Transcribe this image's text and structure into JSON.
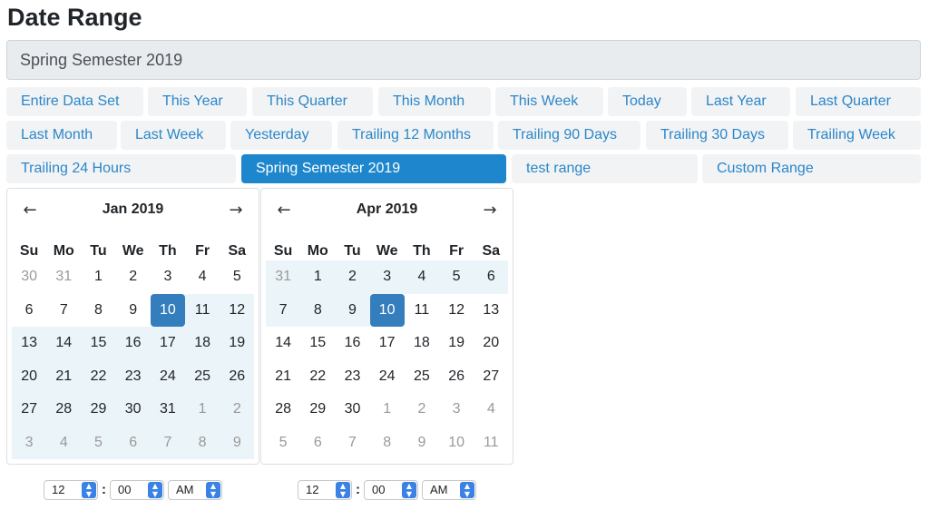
{
  "page": {
    "title": "Date Range"
  },
  "range_input": {
    "value": "Spring Semester 2019"
  },
  "presets": [
    {
      "label": "Entire Data Set"
    },
    {
      "label": "This Year"
    },
    {
      "label": "This Quarter"
    },
    {
      "label": "This Month"
    },
    {
      "label": "This Week"
    },
    {
      "label": "Today"
    },
    {
      "label": "Last Year"
    },
    {
      "label": "Last Quarter"
    },
    {
      "label": "Last Month"
    },
    {
      "label": "Last Week"
    },
    {
      "label": "Yesterday"
    },
    {
      "label": "Trailing 12 Months"
    },
    {
      "label": "Trailing 90 Days"
    },
    {
      "label": "Trailing 30 Days"
    },
    {
      "label": "Trailing Week"
    },
    {
      "label": "Trailing 24 Hours"
    },
    {
      "label": "Spring Semester 2019",
      "active": true
    },
    {
      "label": "test range"
    },
    {
      "label": "Custom Range"
    }
  ],
  "weekdays": [
    "Su",
    "Mo",
    "Tu",
    "We",
    "Th",
    "Fr",
    "Sa"
  ],
  "calendars": [
    {
      "month_label": "Jan 2019",
      "prev_arrow": "←",
      "next_arrow": "→",
      "weeks": [
        [
          {
            "d": "30",
            "off": true
          },
          {
            "d": "31",
            "off": true
          },
          {
            "d": "1"
          },
          {
            "d": "2"
          },
          {
            "d": "3"
          },
          {
            "d": "4"
          },
          {
            "d": "5"
          }
        ],
        [
          {
            "d": "6"
          },
          {
            "d": "7"
          },
          {
            "d": "8"
          },
          {
            "d": "9"
          },
          {
            "d": "10",
            "selected": true
          },
          {
            "d": "11",
            "in": true
          },
          {
            "d": "12",
            "in": true
          }
        ],
        [
          {
            "d": "13",
            "in": true
          },
          {
            "d": "14",
            "in": true
          },
          {
            "d": "15",
            "in": true
          },
          {
            "d": "16",
            "in": true
          },
          {
            "d": "17",
            "in": true
          },
          {
            "d": "18",
            "in": true
          },
          {
            "d": "19",
            "in": true
          }
        ],
        [
          {
            "d": "20",
            "in": true
          },
          {
            "d": "21",
            "in": true
          },
          {
            "d": "22",
            "in": true
          },
          {
            "d": "23",
            "in": true
          },
          {
            "d": "24",
            "in": true
          },
          {
            "d": "25",
            "in": true
          },
          {
            "d": "26",
            "in": true
          }
        ],
        [
          {
            "d": "27",
            "in": true
          },
          {
            "d": "28",
            "in": true
          },
          {
            "d": "29",
            "in": true
          },
          {
            "d": "30",
            "in": true
          },
          {
            "d": "31",
            "in": true
          },
          {
            "d": "1",
            "off": true,
            "in": true
          },
          {
            "d": "2",
            "off": true,
            "in": true
          }
        ],
        [
          {
            "d": "3",
            "off": true,
            "in": true
          },
          {
            "d": "4",
            "off": true,
            "in": true
          },
          {
            "d": "5",
            "off": true,
            "in": true
          },
          {
            "d": "6",
            "off": true,
            "in": true
          },
          {
            "d": "7",
            "off": true,
            "in": true
          },
          {
            "d": "8",
            "off": true,
            "in": true
          },
          {
            "d": "9",
            "off": true,
            "in": true
          }
        ]
      ],
      "time": {
        "hour": "12",
        "minute": "00",
        "ampm": "AM"
      }
    },
    {
      "month_label": "Apr 2019",
      "prev_arrow": "←",
      "next_arrow": "→",
      "weeks": [
        [
          {
            "d": "31",
            "off": true,
            "in": true
          },
          {
            "d": "1",
            "in": true
          },
          {
            "d": "2",
            "in": true
          },
          {
            "d": "3",
            "in": true
          },
          {
            "d": "4",
            "in": true
          },
          {
            "d": "5",
            "in": true
          },
          {
            "d": "6",
            "in": true
          }
        ],
        [
          {
            "d": "7",
            "in": true
          },
          {
            "d": "8",
            "in": true
          },
          {
            "d": "9",
            "in": true
          },
          {
            "d": "10",
            "selected": true
          },
          {
            "d": "11"
          },
          {
            "d": "12"
          },
          {
            "d": "13"
          }
        ],
        [
          {
            "d": "14"
          },
          {
            "d": "15"
          },
          {
            "d": "16"
          },
          {
            "d": "17"
          },
          {
            "d": "18"
          },
          {
            "d": "19"
          },
          {
            "d": "20"
          }
        ],
        [
          {
            "d": "21"
          },
          {
            "d": "22"
          },
          {
            "d": "23"
          },
          {
            "d": "24"
          },
          {
            "d": "25"
          },
          {
            "d": "26"
          },
          {
            "d": "27"
          }
        ],
        [
          {
            "d": "28"
          },
          {
            "d": "29"
          },
          {
            "d": "30"
          },
          {
            "d": "1",
            "off": true
          },
          {
            "d": "2",
            "off": true
          },
          {
            "d": "3",
            "off": true
          },
          {
            "d": "4",
            "off": true
          }
        ],
        [
          {
            "d": "5",
            "off": true
          },
          {
            "d": "6",
            "off": true
          },
          {
            "d": "7",
            "off": true
          },
          {
            "d": "8",
            "off": true
          },
          {
            "d": "9",
            "off": true
          },
          {
            "d": "10",
            "off": true
          },
          {
            "d": "11",
            "off": true
          }
        ]
      ],
      "time": {
        "hour": "12",
        "minute": "00",
        "ampm": "AM"
      }
    }
  ],
  "colors": {
    "accent": "#1e86cc",
    "selected": "#357ebd",
    "in_range": "#ebf4f8",
    "link": "#2b87c8"
  }
}
